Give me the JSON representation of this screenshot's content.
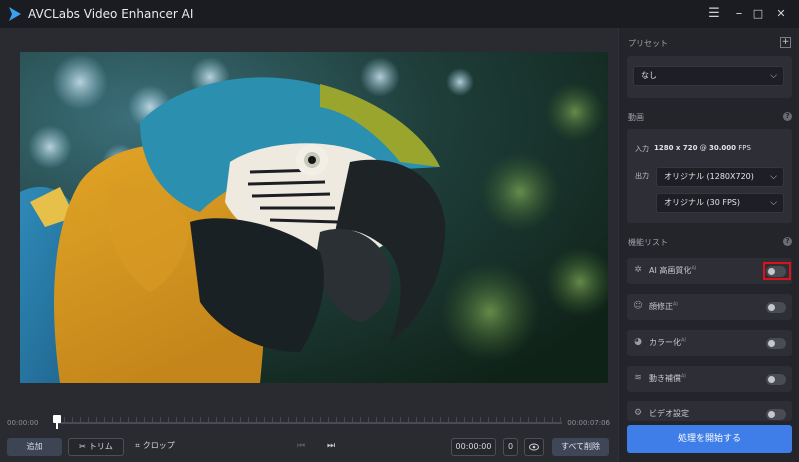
{
  "window": {
    "title": "AVCLabs Video Enhancer AI",
    "controls": {
      "menu": "☰",
      "minimize": "–",
      "maximize": "□",
      "close": "✕"
    }
  },
  "timeline": {
    "start_time": "00:00:00",
    "end_time": "00:00:07:06"
  },
  "bottom_bar": {
    "add_label": "追加",
    "trim_label": "トリム",
    "crop_label": "クロップ",
    "time_value": "00:00:00",
    "count_value": "0",
    "delete_all_label": "すべて削除"
  },
  "preset": {
    "title": "プリセット",
    "add": "+",
    "selected": "なし"
  },
  "video": {
    "title": "動画",
    "input_label": "入力",
    "input_resolution": "1280 x 720",
    "input_at": "@",
    "input_fps_value": "30.000",
    "input_fps_unit": "FPS",
    "output_label": "出力",
    "output_resolution": "オリジナル (1280X720)",
    "output_fps": "オリジナル (30 FPS)"
  },
  "features": {
    "title": "機能リスト",
    "items": [
      {
        "label": "AI 高画質化",
        "sup": "AI",
        "enabled": false
      },
      {
        "label": "顔修正",
        "sup": "AI",
        "enabled": false
      },
      {
        "label": "カラー化",
        "sup": "AI",
        "enabled": false
      },
      {
        "label": "動き補償",
        "sup": "AI",
        "enabled": false
      },
      {
        "label": "ビデオ設定",
        "sup": "",
        "enabled": false
      }
    ]
  },
  "start_button": "処理を開始する",
  "colors": {
    "accent": "#3f7ee8",
    "highlight": "#e0101a"
  }
}
